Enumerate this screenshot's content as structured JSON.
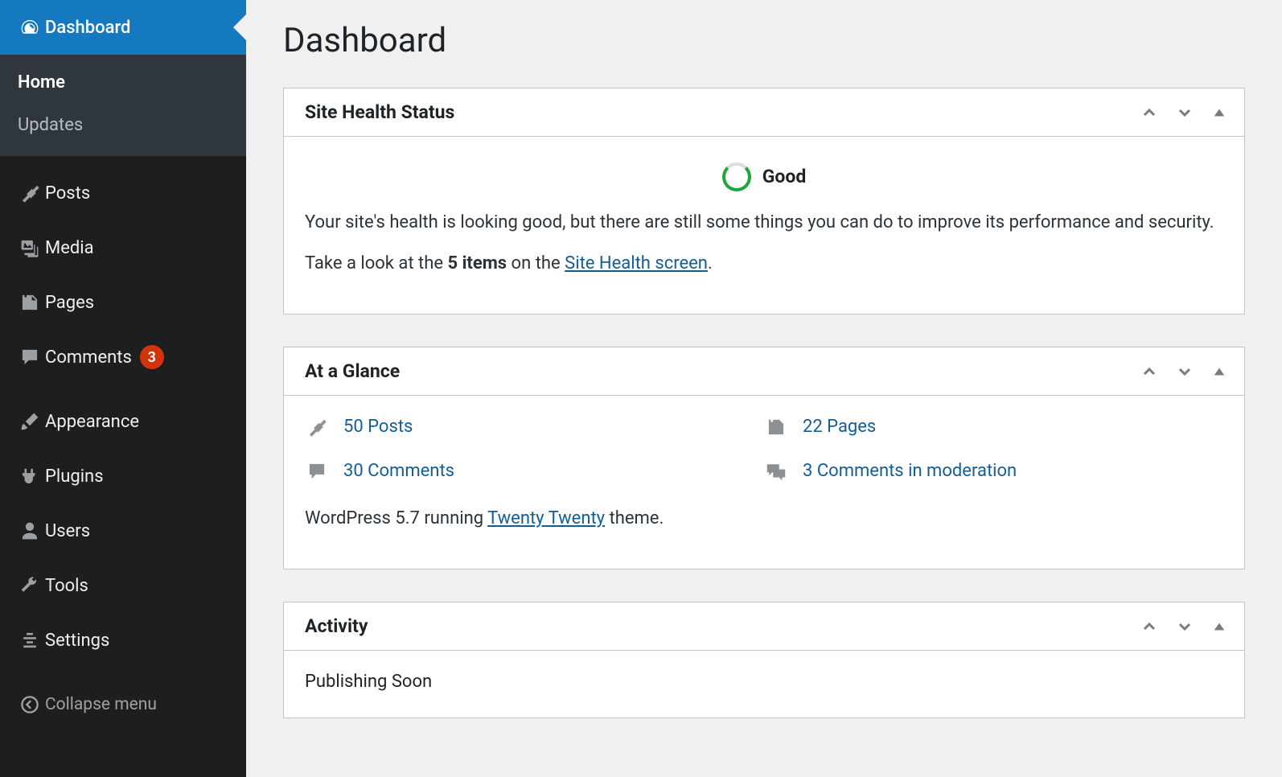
{
  "sidebar": {
    "items": [
      {
        "label": "Dashboard"
      },
      {
        "label": "Posts"
      },
      {
        "label": "Media"
      },
      {
        "label": "Pages"
      },
      {
        "label": "Comments",
        "badge": "3"
      },
      {
        "label": "Appearance"
      },
      {
        "label": "Plugins"
      },
      {
        "label": "Users"
      },
      {
        "label": "Tools"
      },
      {
        "label": "Settings"
      }
    ],
    "submenu": [
      {
        "label": "Home"
      },
      {
        "label": "Updates"
      }
    ],
    "collapse": "Collapse menu"
  },
  "page": {
    "title": "Dashboard"
  },
  "site_health": {
    "heading": "Site Health Status",
    "status": "Good",
    "line1": "Your site's health is looking good, but there are still some things you can do to improve its performance and security.",
    "line2_pre": "Take a look at the ",
    "line2_bold": "5 items",
    "line2_mid": " on the ",
    "line2_link": "Site Health screen",
    "line2_post": "."
  },
  "glance": {
    "heading": "At a Glance",
    "posts_label": "50 Posts",
    "pages_label": "22 Pages",
    "comments_label": "30 Comments",
    "moderation_label": "3 Comments in moderation",
    "footer_pre": "WordPress 5.7 running ",
    "footer_link": "Twenty Twenty",
    "footer_post": " theme."
  },
  "activity": {
    "heading": "Activity",
    "subheading": "Publishing Soon"
  }
}
